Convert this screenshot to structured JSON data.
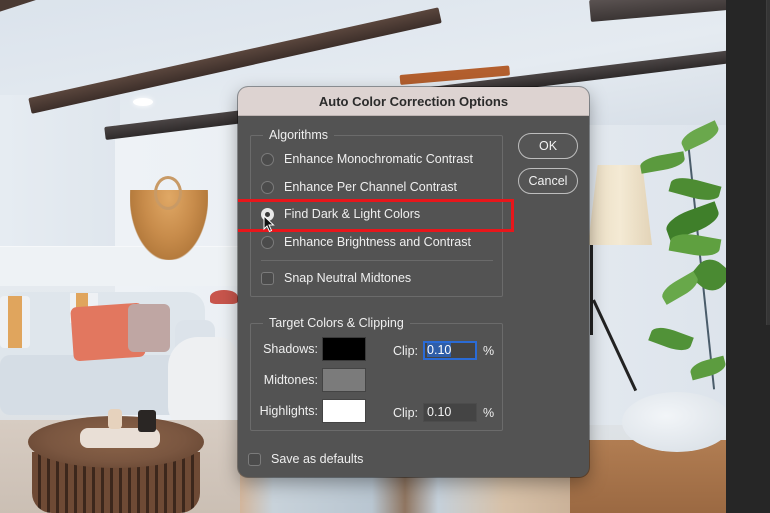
{
  "dialog": {
    "title": "Auto Color Correction Options",
    "algorithms": {
      "legend": "Algorithms",
      "options": [
        {
          "label": "Enhance Monochromatic Contrast",
          "selected": false
        },
        {
          "label": "Enhance Per Channel Contrast",
          "selected": false
        },
        {
          "label": "Find Dark & Light Colors",
          "selected": true
        },
        {
          "label": "Enhance Brightness and Contrast",
          "selected": false
        }
      ],
      "snap_neutral_midtones": {
        "label": "Snap Neutral Midtones",
        "checked": false
      }
    },
    "target": {
      "legend": "Target Colors & Clipping",
      "shadows": {
        "label": "Shadows:",
        "color": "#000000",
        "clip_label": "Clip:",
        "clip_value": "0.10",
        "unit": "%"
      },
      "midtones": {
        "label": "Midtones:",
        "color": "#7b7b7b"
      },
      "highlights": {
        "label": "Highlights:",
        "color": "#ffffff",
        "clip_label": "Clip:",
        "clip_value": "0.10",
        "unit": "%"
      }
    },
    "save_as_defaults": {
      "label": "Save as defaults",
      "checked": false
    },
    "buttons": {
      "ok": "OK",
      "cancel": "Cancel"
    }
  },
  "annotation": {
    "highlight_color": "#e8161b",
    "highlighted_option": "Find Dark & Light Colors"
  },
  "background": {
    "description": "Living room photo with white sofa, round wooden coffee table, floor lamp and fiddle-leaf fig plant"
  }
}
